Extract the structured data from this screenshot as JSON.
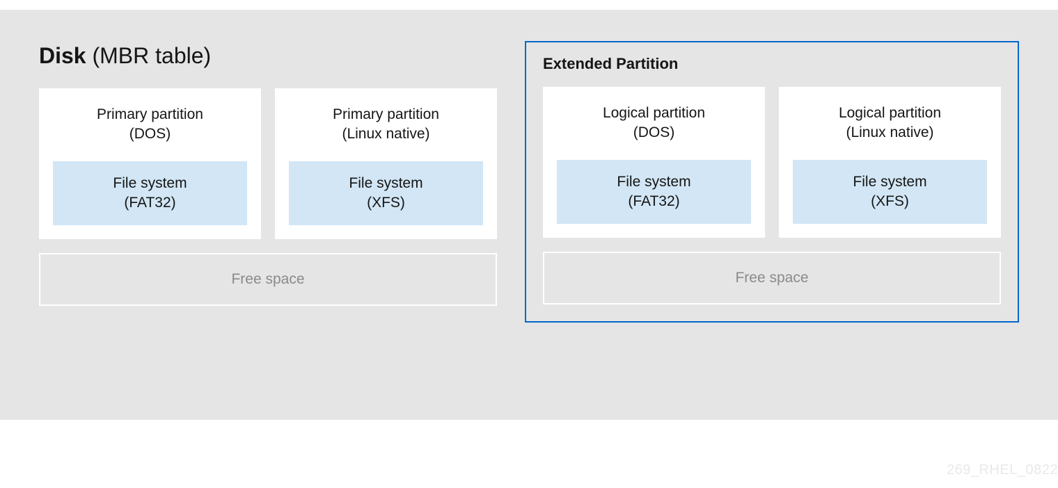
{
  "title": {
    "bold": "Disk",
    "rest": " (MBR table)"
  },
  "left": {
    "partitions": [
      {
        "name": "Primary partition",
        "type": "(DOS)",
        "fs_label": "File system",
        "fs_type": "(FAT32)"
      },
      {
        "name": "Primary partition",
        "type": "(Linux native)",
        "fs_label": "File system",
        "fs_type": "(XFS)"
      }
    ],
    "free": "Free space"
  },
  "right": {
    "title": "Extended Partition",
    "partitions": [
      {
        "name": "Logical partition",
        "type": "(DOS)",
        "fs_label": "File system",
        "fs_type": "(FAT32)"
      },
      {
        "name": "Logical partition",
        "type": "(Linux native)",
        "fs_label": "File system",
        "fs_type": "(XFS)"
      }
    ],
    "free": "Free space"
  },
  "watermark": "269_RHEL_0822"
}
